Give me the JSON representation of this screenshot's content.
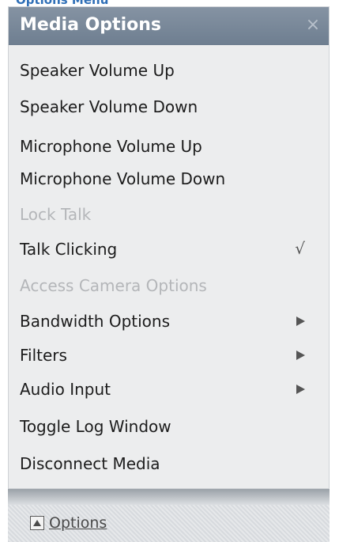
{
  "page_label": "Options Menu",
  "menu": {
    "title": "Media Options",
    "close_symbol": "×",
    "items": [
      {
        "label": "Speaker Volume Up",
        "enabled": true,
        "indicator": ""
      },
      {
        "label": "Speaker Volume Down",
        "enabled": true,
        "indicator": ""
      },
      {
        "label": "Microphone Volume Up",
        "enabled": true,
        "indicator": ""
      },
      {
        "label": "Microphone Volume Down",
        "enabled": true,
        "indicator": ""
      },
      {
        "label": "Lock Talk",
        "enabled": false,
        "indicator": ""
      },
      {
        "label": "Talk Clicking",
        "enabled": true,
        "indicator": "check-icon"
      },
      {
        "label": "Access Camera Options",
        "enabled": false,
        "indicator": ""
      },
      {
        "label": "Bandwidth Options",
        "enabled": true,
        "indicator": "submenu-arrow-icon"
      },
      {
        "label": "Filters",
        "enabled": true,
        "indicator": "submenu-arrow-icon"
      },
      {
        "label": "Audio Input",
        "enabled": true,
        "indicator": "submenu-arrow-icon"
      },
      {
        "label": "Toggle Log Window",
        "enabled": true,
        "indicator": ""
      },
      {
        "label": "Disconnect Media",
        "enabled": true,
        "indicator": ""
      }
    ],
    "check_symbol": "√"
  },
  "footer": {
    "options_label": "Options",
    "icon": "up-triangle-icon"
  },
  "colors": {
    "header_bg": "#7a8899",
    "menu_bg": "#ecedee",
    "disabled_text": "#b4b6b9",
    "link_text": "#4a4a4a"
  }
}
